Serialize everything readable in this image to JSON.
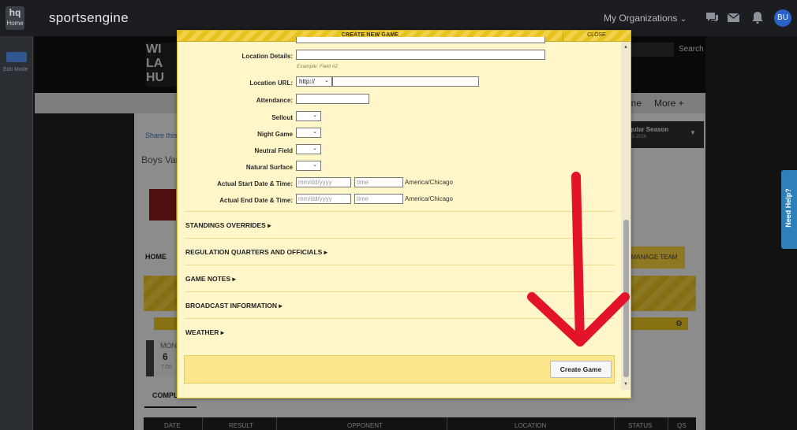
{
  "topbar": {
    "hq_label": "hq",
    "home_label": "Home",
    "brand": "sportsengine",
    "my_orgs": "My Organizations",
    "avatar_initials": "BU"
  },
  "rail": {
    "edit_mode": "Edit Mode"
  },
  "site": {
    "search_label": "Search",
    "nav_items": [
      "ine",
      "More +"
    ],
    "share_label": "Share this",
    "team_title": "Boys Var",
    "home_tab": "HOME",
    "season_label": "gular Season",
    "season_sub": "25-2026",
    "manage_team": "MANAGE TEAM",
    "mon_label": "MON",
    "mon_day": "6",
    "mon_time": "7:00",
    "completed_tab": "COMPL",
    "table_headers": [
      "DATE",
      "RESULT",
      "OPPONENT",
      "LOCATION",
      "STATUS",
      "QS"
    ]
  },
  "need_help": "Need Help?",
  "modal": {
    "title": "CREATE NEW GAME",
    "close": "CLOSE",
    "fields": {
      "location_details": {
        "label": "Location Details:",
        "hint": "Example: Field #2"
      },
      "location_url": {
        "label": "Location URL:",
        "scheme": "http://"
      },
      "attendance": {
        "label": "Attendance:"
      },
      "sellout": {
        "label": "Sellout"
      },
      "night_game": {
        "label": "Night Game"
      },
      "neutral_field": {
        "label": "Neutral Field"
      },
      "natural_surface": {
        "label": "Natural Surface"
      },
      "start": {
        "label": "Actual Start Date & Time:",
        "date_placeholder": "mm/dd/yyyy",
        "time_placeholder": "time",
        "tz": "America/Chicago"
      },
      "end": {
        "label": "Actual End Date & Time:",
        "date_placeholder": "mm/dd/yyyy",
        "time_placeholder": "time",
        "tz": "America/Chicago"
      }
    },
    "sections": [
      "STANDINGS OVERRIDES ▸",
      "REGULATION QUARTERS AND OFFICIALS ▸",
      "GAME NOTES ▸",
      "BROADCAST INFORMATION ▸",
      "WEATHER ▸"
    ],
    "create_button": "Create Game"
  },
  "colors": {
    "modal_bg": "#fff7c9",
    "stripe": "#e7c11d",
    "arrow": "#e3142a",
    "brand_blue": "#2a62c9"
  }
}
